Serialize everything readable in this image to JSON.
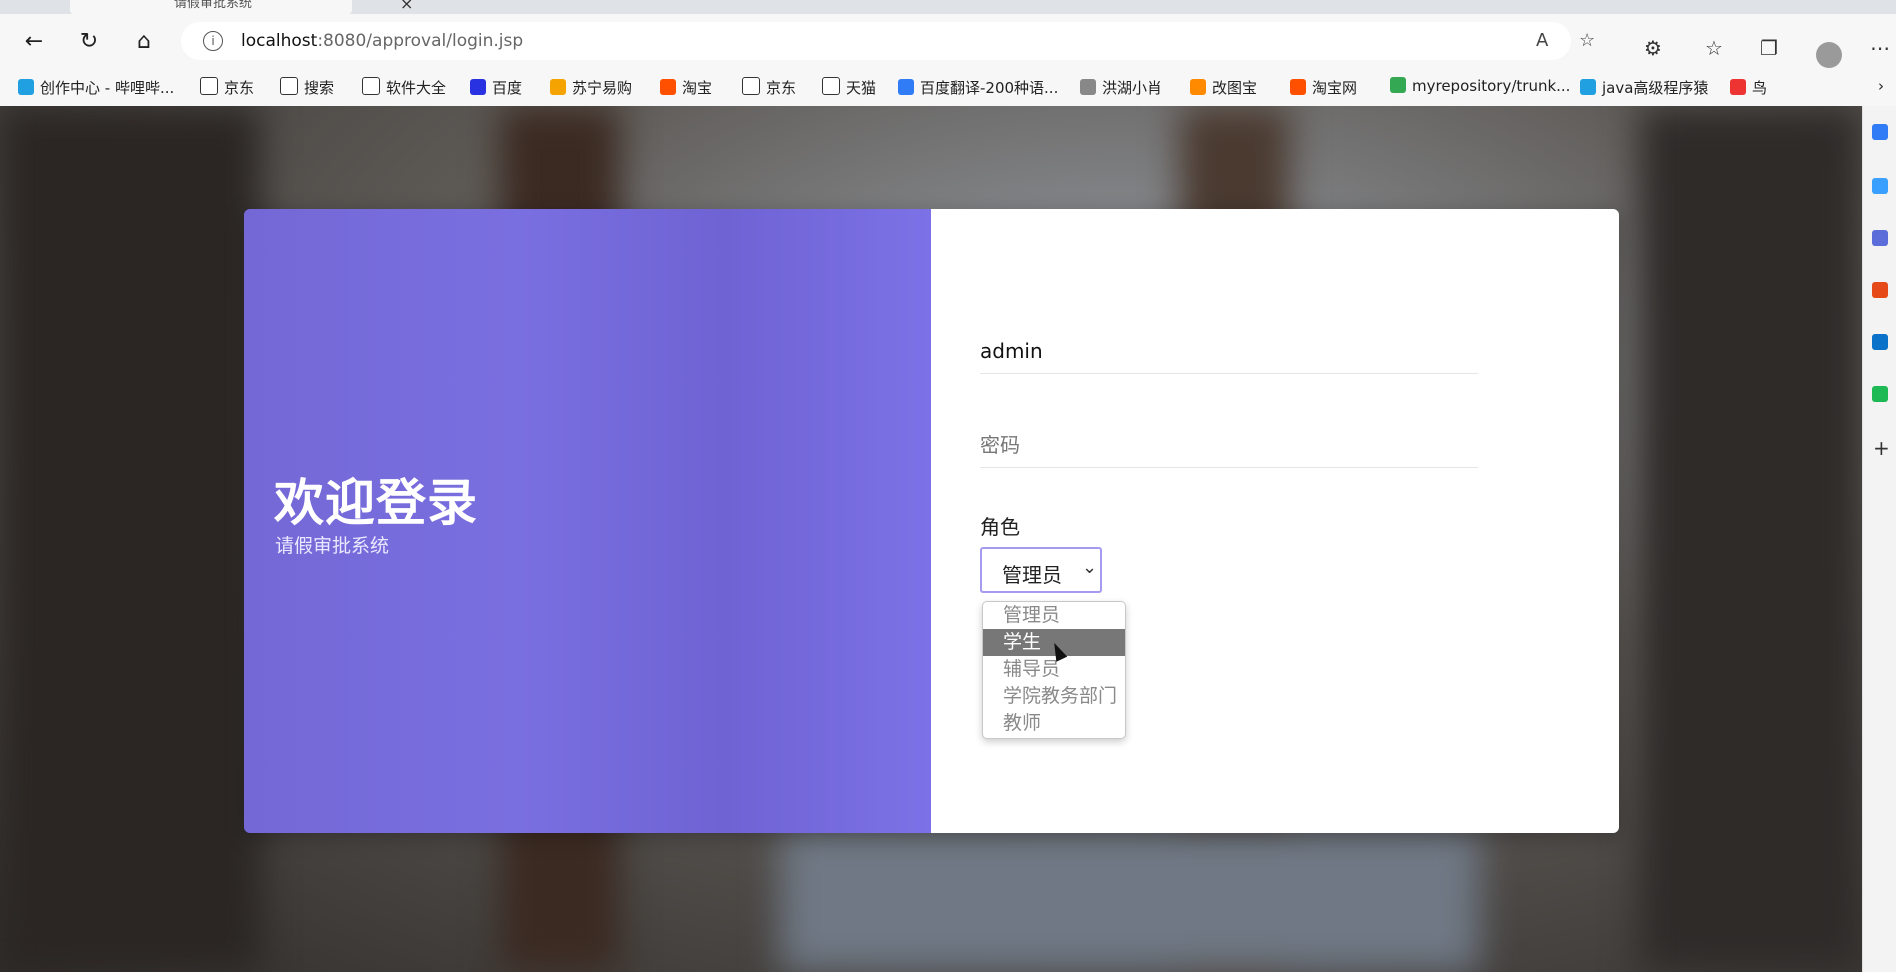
{
  "browser": {
    "tab_title": "请假审批系统",
    "url_host": "localhost",
    "url_rest": ":8080/approval/login.jsp",
    "bookmarks": [
      {
        "label": "创作中心 - 哔哩哔...",
        "color": "#20a0e0"
      },
      {
        "label": "京东",
        "color": "#ffffff"
      },
      {
        "label": "搜索",
        "color": "#ffffff"
      },
      {
        "label": "软件大全",
        "color": "#ffffff"
      },
      {
        "label": "百度",
        "color": "#2932e1"
      },
      {
        "label": "苏宁易购",
        "color": "#f5a300"
      },
      {
        "label": "淘宝",
        "color": "#ff5000"
      },
      {
        "label": "京东",
        "color": "#ffffff"
      },
      {
        "label": "天猫",
        "color": "#ffffff"
      },
      {
        "label": "百度翻译-200种语...",
        "color": "#2f7cf6"
      },
      {
        "label": "洪湖小肖",
        "color": "#888888"
      },
      {
        "label": "改图宝",
        "color": "#ff8a00"
      },
      {
        "label": "淘宝网",
        "color": "#ff5000"
      },
      {
        "label": "myrepository/trunk...",
        "color": "#34a853"
      },
      {
        "label": "java高级程序猿",
        "color": "#20a0e0"
      },
      {
        "label": "鸟",
        "color": "#e33"
      }
    ]
  },
  "login": {
    "welcome": "欢迎登录",
    "subtitle": "请假审批系统",
    "username_value": "admin",
    "password_placeholder": "密码",
    "role_label": "角色",
    "role_selected": "管理员",
    "role_options": [
      "管理员",
      "学生",
      "辅导员",
      "学院教务部门",
      "教师"
    ],
    "highlighted_option": "学生"
  },
  "colors": {
    "panel": "#7468d6",
    "select_border": "#a49bf0",
    "highlight": "#777777"
  }
}
